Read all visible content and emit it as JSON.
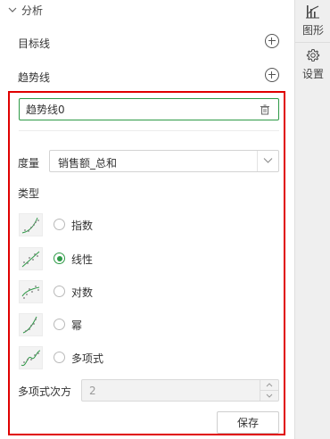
{
  "section": {
    "title": "分析"
  },
  "target_line": {
    "label": "目标线"
  },
  "trend_line": {
    "label": "趋势线"
  },
  "trend_item": {
    "name": "趋势线0"
  },
  "measure": {
    "label": "度量",
    "value": "销售额_总和"
  },
  "type": {
    "label": "类型",
    "options": [
      {
        "label": "指数",
        "icon": "exponential-chart-icon",
        "selected": false
      },
      {
        "label": "线性",
        "icon": "linear-chart-icon",
        "selected": true
      },
      {
        "label": "对数",
        "icon": "logarithmic-chart-icon",
        "selected": false
      },
      {
        "label": "幂",
        "icon": "power-chart-icon",
        "selected": false
      },
      {
        "label": "多项式",
        "icon": "polynomial-chart-icon",
        "selected": false
      }
    ]
  },
  "polynomial": {
    "label": "多项式次方",
    "value": "2"
  },
  "save": {
    "label": "保存"
  },
  "rail": {
    "chart": "图形",
    "settings": "设置"
  },
  "colors": {
    "accent": "#2e9a47",
    "highlight": "#e00000"
  }
}
